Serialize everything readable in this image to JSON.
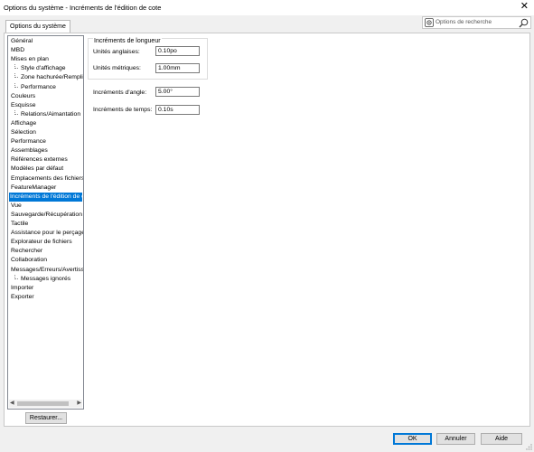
{
  "window": {
    "title": "Options du système - Incréments de l'édition de cote",
    "close_glyph": "✕"
  },
  "tabs": [
    {
      "label": "Options du système"
    }
  ],
  "search": {
    "placeholder": "Options de recherche",
    "gear_icon": "gear-icon",
    "search_icon": "magnifier-icon"
  },
  "tree": {
    "items": [
      {
        "label": "Général",
        "level": 0
      },
      {
        "label": "MBD",
        "level": 0
      },
      {
        "label": "Mises en plan",
        "level": 0
      },
      {
        "label": "Style d'affichage",
        "level": 1
      },
      {
        "label": "Zone hachurée/Remplir",
        "level": 1
      },
      {
        "label": "Performance",
        "level": 1
      },
      {
        "label": "Couleurs",
        "level": 0
      },
      {
        "label": "Esquisse",
        "level": 0
      },
      {
        "label": "Relations/Aimantation",
        "level": 1
      },
      {
        "label": "Affichage",
        "level": 0
      },
      {
        "label": "Sélection",
        "level": 0
      },
      {
        "label": "Performance",
        "level": 0
      },
      {
        "label": "Assemblages",
        "level": 0
      },
      {
        "label": "Références externes",
        "level": 0
      },
      {
        "label": "Modèles par défaut",
        "level": 0
      },
      {
        "label": "Emplacements des fichiers",
        "level": 0
      },
      {
        "label": "FeatureManager",
        "level": 0
      },
      {
        "label": "Incréments de l'édition de cote",
        "level": 0,
        "selected": true
      },
      {
        "label": "Vue",
        "level": 0
      },
      {
        "label": "Sauvegarde/Récupération",
        "level": 0
      },
      {
        "label": "Tactile",
        "level": 0
      },
      {
        "label": "Assistance pour le perçage/Toolbox",
        "level": 0
      },
      {
        "label": "Explorateur de fichiers",
        "level": 0
      },
      {
        "label": "Rechercher",
        "level": 0
      },
      {
        "label": "Collaboration",
        "level": 0
      },
      {
        "label": "Messages/Erreurs/Avertissements",
        "level": 0
      },
      {
        "label": "Messages ignorés",
        "level": 1
      },
      {
        "label": "Importer",
        "level": 0
      },
      {
        "label": "Exporter",
        "level": 0
      }
    ]
  },
  "length_group": {
    "legend": "Incréments de longueur",
    "english_label": "Unités anglaises:",
    "english_value": "0.10po",
    "metric_label": "Unités métriques:",
    "metric_value": "1.00mm"
  },
  "angle": {
    "label": "Incréments d'angle:",
    "value": "5.00°"
  },
  "time": {
    "label": "Incréments de temps:",
    "value": "0.10s"
  },
  "buttons": {
    "restore": "Restaurer...",
    "ok": "OK",
    "cancel": "Annuler",
    "help": "Aide"
  }
}
